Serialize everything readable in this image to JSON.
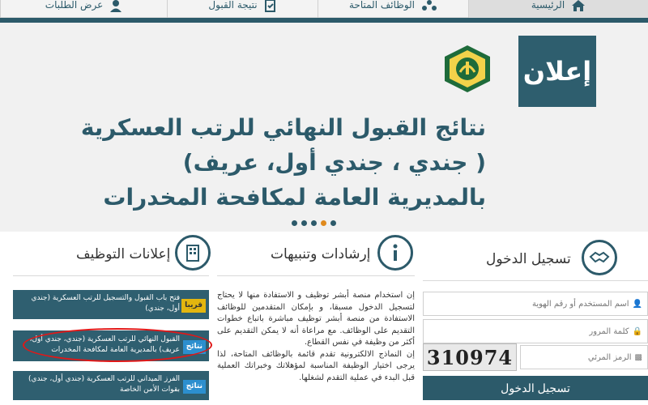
{
  "nav": {
    "items": [
      {
        "label": "الرئيسية",
        "icon": "home-icon"
      },
      {
        "label": "الوظائف المتاحة",
        "icon": "org-chart-icon"
      },
      {
        "label": "نتيجة القبول",
        "icon": "result-icon"
      },
      {
        "label": "عرض الطلبات",
        "icon": "user-icon"
      }
    ]
  },
  "banner": {
    "announce_label": "إعلان",
    "headline_lines": [
      "نتائج القبول النهائي للرتب العسكرية",
      "( جندي ، جندي أول، عريف)",
      "بالمديرية العامة لمكافحة المخدرات"
    ]
  },
  "login": {
    "title": "تسجيل الدخول",
    "username_placeholder": "اسم المستخدم أو رقم الهوية",
    "password_placeholder": "كلمة المرور",
    "captcha_placeholder": "الرمز المرئي",
    "captcha_text": "310974",
    "submit_label": "تسجيل الدخول"
  },
  "guidance": {
    "title": "إرشادات وتنبيهات",
    "paragraphs": [
      "إن استخدام منصة أبشر توظيف و الاستفادة منها لا يحتاج لتسجيل الدخول مسبقا، و بإمكان المتقدمين للوظائف الاستفادة من منصة أبشر توظيف مباشرة باتباع خطوات التقديم على الوظائف. مع مراعاة أنه لا يمكن التقديم على أكثر من وظيفة في نفس القطاع.",
      "إن النماذج الالكترونية تقدم قائمة بالوظائف المتاحة، لذا يرجى اختيار الوظيفة المناسبة لمؤهلاتك وخبراتك العملية قبل البدء في عملية التقدم لشغلها."
    ]
  },
  "jobs": {
    "title": "إعلانات التوظيف",
    "cards": [
      {
        "badge": "قريبا",
        "text": "فتح باب القبول والتسجيل للرتب العسكرية (جندي أول، جندي)"
      },
      {
        "badge": "نتائج",
        "text": "القبول النهائي للرتب العسكرية (جندي، جندي أول، عريف) بالمديرية العامة لمكافحة المخدرات"
      },
      {
        "badge": "نتائج",
        "text": "الفرز الميداني للرتب العسكرية (جندي أول، جندي) بقوات الأمن الخاصة"
      }
    ]
  },
  "colors": {
    "primary": "#2c5a6a",
    "accent_dot": "#e08a1e",
    "badge_soon": "#e3b60f",
    "badge_result": "#2c8fcf",
    "highlight": "#e01818"
  }
}
